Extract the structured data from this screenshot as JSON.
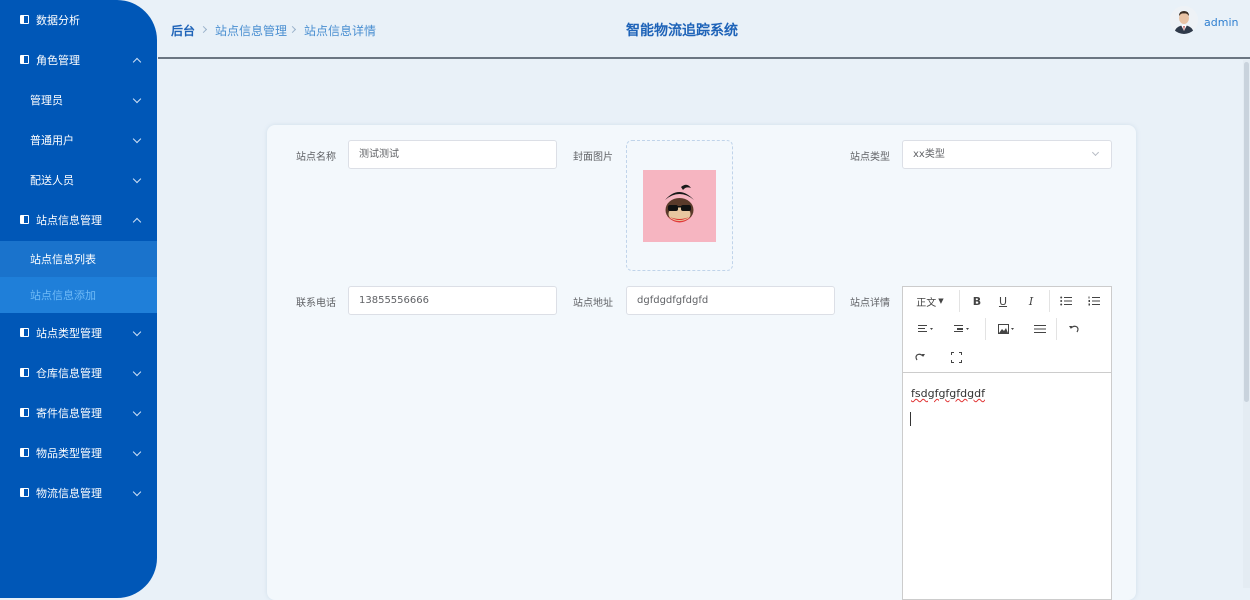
{
  "sidebar": {
    "items": [
      {
        "label": "数据分析"
      },
      {
        "label": "角色管理"
      },
      {
        "label": "管理员"
      },
      {
        "label": "普通用户"
      },
      {
        "label": "配送人员"
      },
      {
        "label": "站点信息管理"
      },
      {
        "label": "站点信息列表"
      },
      {
        "label": "站点信息添加"
      },
      {
        "label": "站点类型管理"
      },
      {
        "label": "仓库信息管理"
      },
      {
        "label": "寄件信息管理"
      },
      {
        "label": "物品类型管理"
      },
      {
        "label": "物流信息管理"
      }
    ]
  },
  "header": {
    "breadcrumb": [
      "后台",
      "站点信息管理",
      "站点信息详情"
    ],
    "title": "智能物流追踪系统",
    "user": "admin"
  },
  "form": {
    "name_label": "站点名称",
    "name_value": "测试测试",
    "cover_label": "封面图片",
    "type_label": "站点类型",
    "type_value": "xx类型",
    "phone_label": "联系电话",
    "phone_value": "13855556666",
    "address_label": "站点地址",
    "address_value": "dgfdgdfgfdgfd",
    "detail_label": "站点详情"
  },
  "editor": {
    "heading_select": "正文",
    "content": "fsdgfgfgfdgdf"
  },
  "colors": {
    "sidebar_bg": "#0057b7",
    "accent": "#1e63b8",
    "page_bg": "#e9f1f8"
  }
}
